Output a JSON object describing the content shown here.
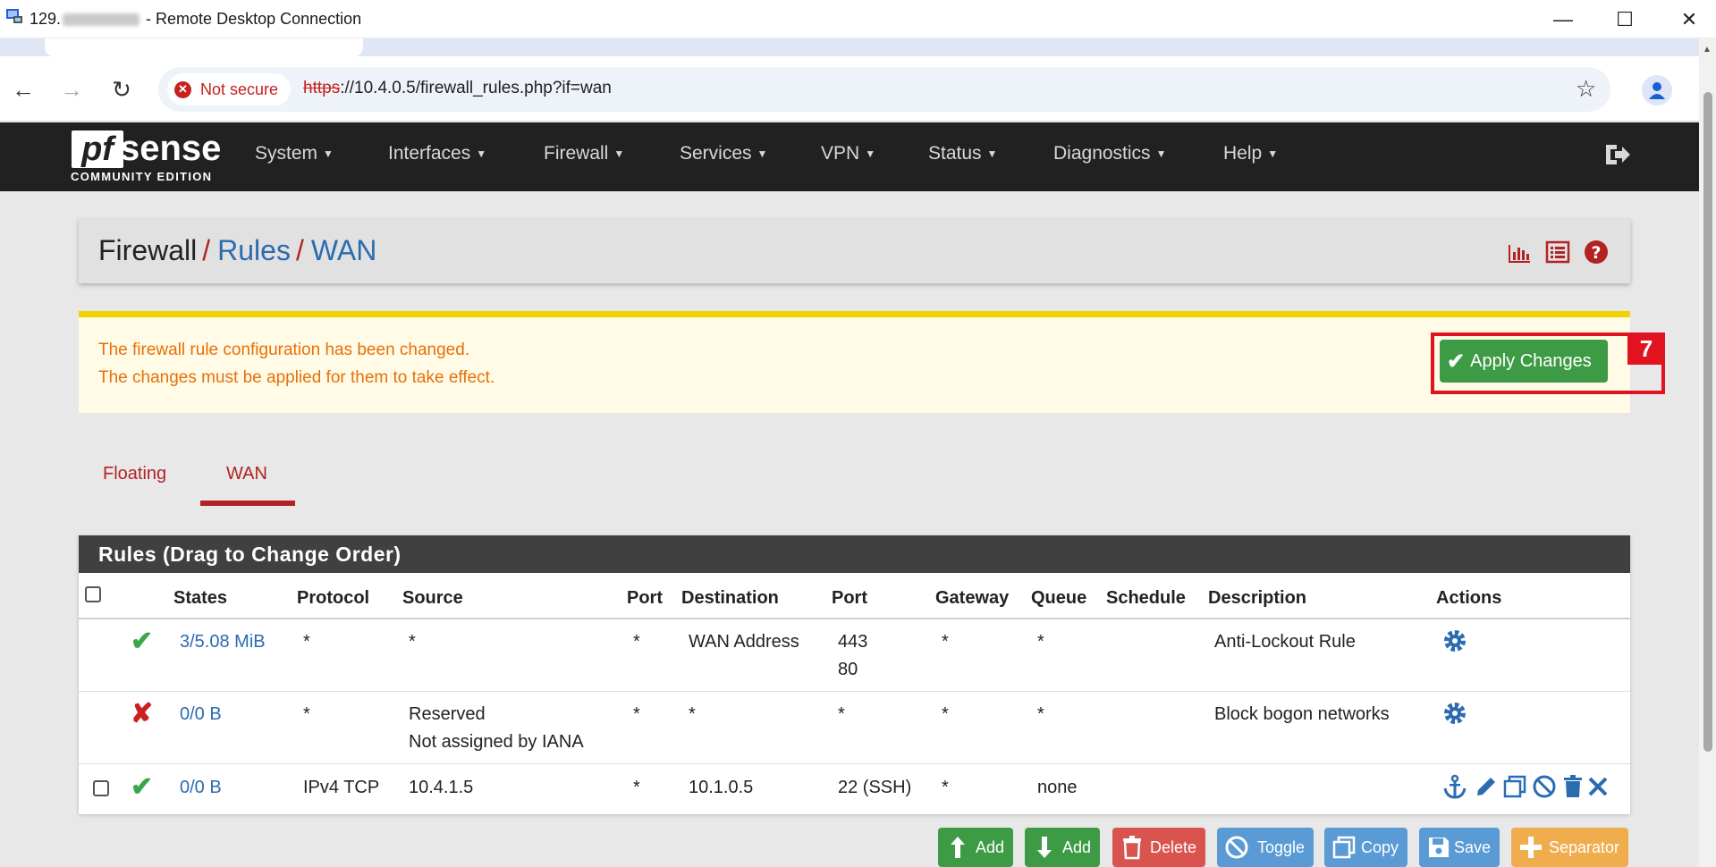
{
  "window": {
    "title_prefix": "129.",
    "title_suffix": " - Remote Desktop Connection",
    "minimize": "—",
    "maximize": "☐",
    "close": "✕"
  },
  "browser": {
    "security_label": "Not secure",
    "url_scheme": "https",
    "url_rest": "://10.4.0.5/firewall_rules.php?if=wan"
  },
  "logo": {
    "brand_pf": "pf",
    "brand_sense": "sense",
    "edition": "COMMUNITY EDITION"
  },
  "nav": [
    "System",
    "Interfaces",
    "Firewall",
    "Services",
    "VPN",
    "Status",
    "Diagnostics",
    "Help"
  ],
  "breadcrumb": {
    "root": "Firewall",
    "level1": "Rules",
    "level2": "WAN",
    "separator": "/"
  },
  "alert": {
    "line1": "The firewall rule configuration has been changed.",
    "line2": "The changes must be applied for them to take effect.",
    "apply_label": "Apply Changes",
    "annotation_number": "7",
    "color_text": "#e6700a",
    "color_bar": "#f2d200"
  },
  "tabs": [
    "Floating",
    "WAN"
  ],
  "active_tab": "WAN",
  "rules": {
    "panel_title": "Rules (Drag to Change Order)",
    "columns": [
      "States",
      "Protocol",
      "Source",
      "Port",
      "Destination",
      "Port",
      "Gateway",
      "Queue",
      "Schedule",
      "Description",
      "Actions"
    ],
    "rows": [
      {
        "status": "pass",
        "states": "3/5.08 MiB",
        "protocol": "*",
        "source": "*",
        "source_port": "*",
        "destination": "WAN Address",
        "dest_port_1": "443",
        "dest_port_2": "80",
        "gateway": "*",
        "queue": "*",
        "schedule": "",
        "description": "Anti-Lockout Rule"
      },
      {
        "status": "block",
        "states": "0/0 B",
        "protocol": "*",
        "source_1": "Reserved",
        "source_2": "Not assigned by IANA",
        "source_port": "*",
        "destination": "*",
        "dest_port": "*",
        "gateway": "*",
        "queue": "*",
        "schedule": "",
        "description": "Block bogon networks"
      },
      {
        "status": "pass",
        "states": "0/0 B",
        "protocol": "IPv4 TCP",
        "source": "10.4.1.5",
        "source_port": "*",
        "destination": "10.1.0.5",
        "dest_port": "22 (SSH)",
        "gateway": "*",
        "queue": "none",
        "schedule": "",
        "description": ""
      }
    ]
  },
  "buttons": {
    "add_top": "Add",
    "add_bottom": "Add",
    "delete": "Delete",
    "toggle": "Toggle",
    "copy": "Copy",
    "save": "Save",
    "separator": "Separator"
  },
  "colors": {
    "navbar": "#212121",
    "link": "#2b6cb0",
    "accent_red": "#b22222",
    "success": "#3e9b45",
    "danger": "#d9534f",
    "info": "#5b9bd5",
    "warning": "#f0ad4e"
  }
}
